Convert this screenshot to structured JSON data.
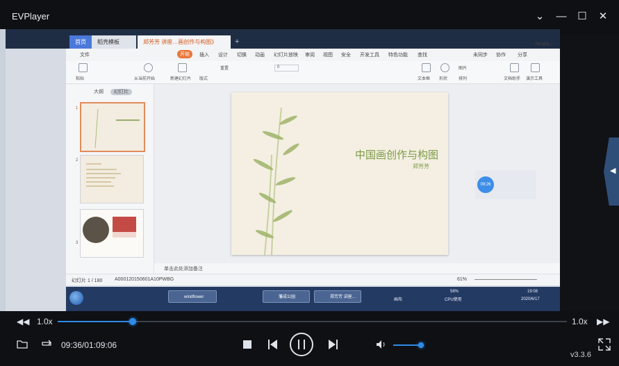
{
  "app": {
    "title": "EVPlayer",
    "version": "v3.3.6"
  },
  "window_controls": {
    "dropdown": "⌄",
    "minimize": "—",
    "maximize": "☐",
    "close": "✕"
  },
  "wps": {
    "tabs": [
      {
        "label": "首页"
      },
      {
        "label": "稻壳模板"
      },
      {
        "label": "郑芳芳 讲座…画创作与构图》"
      }
    ],
    "new_tab": "+",
    "menu": [
      "文件",
      "开始",
      "插入",
      "设计",
      "切换",
      "动画",
      "幻灯片放映",
      "审阅",
      "视图",
      "安全",
      "开发工具",
      "特色功能",
      "查找"
    ],
    "menu_active": "开始",
    "menu_right": [
      "未同步",
      "协作",
      "分享"
    ],
    "user": "fangfa…",
    "ribbon_labels": [
      "粘贴",
      "从当前开始",
      "新建幻灯片",
      "版式",
      "重置",
      "文本框",
      "形状",
      "图片",
      "排列",
      "文档助手",
      "演示工具"
    ],
    "font_size": "0",
    "panel_tabs": [
      "大纲",
      "幻灯片"
    ],
    "panel_active": "幻灯片",
    "slide_numbers": [
      "1",
      "2",
      "3"
    ],
    "panel_add": "+",
    "slide": {
      "title": "中国画创作与构图",
      "author": "郑芳芳"
    },
    "timer_bubble": "09:26",
    "notes_placeholder": "单击此处添加备注",
    "status": {
      "slide_count": "幻灯片 1 / 180",
      "theme": "A000120150601A10PWBG",
      "zoom": "61%"
    }
  },
  "taskbar": {
    "items": [
      "windflower",
      "藩成公园",
      "郑芳芳 讲座…"
    ],
    "tray": {
      "cpu": "58%",
      "cpu_label": "CPU使用",
      "time": "19:08",
      "date": "2020/6/17",
      "ime": "画布"
    }
  },
  "player": {
    "speed_left": "1.0x",
    "speed_right": "1.0x",
    "time": "09:36/01:09:06",
    "progress_fraction": 0.148,
    "volume_fraction": 0.9
  },
  "colors": {
    "accent": "#2f8be8",
    "background": "#0e1014",
    "wps_orange": "#e8763a",
    "slide_green": "#7a9a45"
  }
}
